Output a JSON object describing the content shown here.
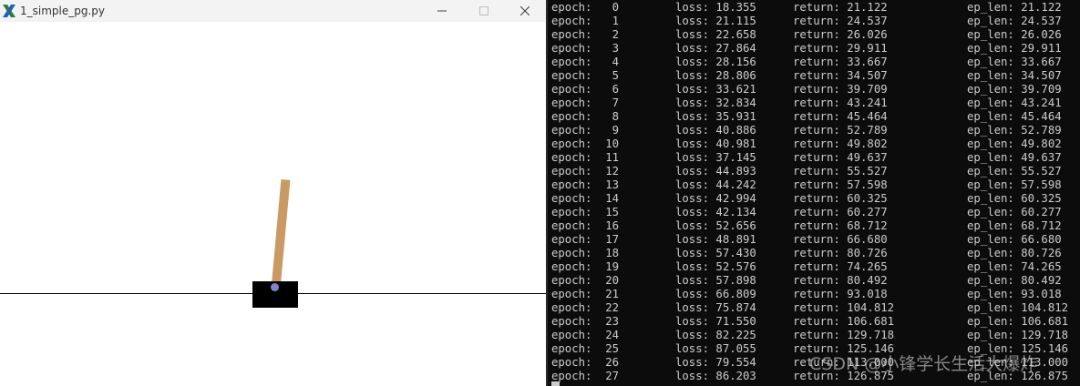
{
  "window": {
    "title": "1_simple_pg.py",
    "icon": "x-app-icon",
    "controls": [
      "minimize-icon",
      "maximize-icon",
      "close-icon"
    ]
  },
  "scene": {
    "track_color": "#000000",
    "cart_color": "#000000",
    "pole_color": "#ca9a65",
    "axle_color": "#8183cf"
  },
  "terminal": {
    "rows": [
      {
        "epoch": "epoch:   0",
        "loss": "loss: 18.355",
        "return": "return: 21.122",
        "ep_len": "ep_len: 21.122"
      },
      {
        "epoch": "epoch:   1",
        "loss": "loss: 21.115",
        "return": "return: 24.537",
        "ep_len": "ep_len: 24.537"
      },
      {
        "epoch": "epoch:   2",
        "loss": "loss: 22.658",
        "return": "return: 26.026",
        "ep_len": "ep_len: 26.026"
      },
      {
        "epoch": "epoch:   3",
        "loss": "loss: 27.864",
        "return": "return: 29.911",
        "ep_len": "ep_len: 29.911"
      },
      {
        "epoch": "epoch:   4",
        "loss": "loss: 28.156",
        "return": "return: 33.667",
        "ep_len": "ep_len: 33.667"
      },
      {
        "epoch": "epoch:   5",
        "loss": "loss: 28.806",
        "return": "return: 34.507",
        "ep_len": "ep_len: 34.507"
      },
      {
        "epoch": "epoch:   6",
        "loss": "loss: 33.621",
        "return": "return: 39.709",
        "ep_len": "ep_len: 39.709"
      },
      {
        "epoch": "epoch:   7",
        "loss": "loss: 32.834",
        "return": "return: 43.241",
        "ep_len": "ep_len: 43.241"
      },
      {
        "epoch": "epoch:   8",
        "loss": "loss: 35.931",
        "return": "return: 45.464",
        "ep_len": "ep_len: 45.464"
      },
      {
        "epoch": "epoch:   9",
        "loss": "loss: 40.886",
        "return": "return: 52.789",
        "ep_len": "ep_len: 52.789"
      },
      {
        "epoch": "epoch:  10",
        "loss": "loss: 40.981",
        "return": "return: 49.802",
        "ep_len": "ep_len: 49.802"
      },
      {
        "epoch": "epoch:  11",
        "loss": "loss: 37.145",
        "return": "return: 49.637",
        "ep_len": "ep_len: 49.637"
      },
      {
        "epoch": "epoch:  12",
        "loss": "loss: 44.893",
        "return": "return: 55.527",
        "ep_len": "ep_len: 55.527"
      },
      {
        "epoch": "epoch:  13",
        "loss": "loss: 44.242",
        "return": "return: 57.598",
        "ep_len": "ep_len: 57.598"
      },
      {
        "epoch": "epoch:  14",
        "loss": "loss: 42.994",
        "return": "return: 60.325",
        "ep_len": "ep_len: 60.325"
      },
      {
        "epoch": "epoch:  15",
        "loss": "loss: 42.134",
        "return": "return: 60.277",
        "ep_len": "ep_len: 60.277"
      },
      {
        "epoch": "epoch:  16",
        "loss": "loss: 52.656",
        "return": "return: 68.712",
        "ep_len": "ep_len: 68.712"
      },
      {
        "epoch": "epoch:  17",
        "loss": "loss: 48.891",
        "return": "return: 66.680",
        "ep_len": "ep_len: 66.680"
      },
      {
        "epoch": "epoch:  18",
        "loss": "loss: 57.430",
        "return": "return: 80.726",
        "ep_len": "ep_len: 80.726"
      },
      {
        "epoch": "epoch:  19",
        "loss": "loss: 52.576",
        "return": "return: 74.265",
        "ep_len": "ep_len: 74.265"
      },
      {
        "epoch": "epoch:  20",
        "loss": "loss: 57.898",
        "return": "return: 80.492",
        "ep_len": "ep_len: 80.492"
      },
      {
        "epoch": "epoch:  21",
        "loss": "loss: 66.809",
        "return": "return: 93.018",
        "ep_len": "ep_len: 93.018"
      },
      {
        "epoch": "epoch:  22",
        "loss": "loss: 75.874",
        "return": "return: 104.812",
        "ep_len": "ep_len: 104.812"
      },
      {
        "epoch": "epoch:  23",
        "loss": "loss: 71.550",
        "return": "return: 106.681",
        "ep_len": "ep_len: 106.681"
      },
      {
        "epoch": "epoch:  24",
        "loss": "loss: 82.225",
        "return": "return: 129.718",
        "ep_len": "ep_len: 129.718"
      },
      {
        "epoch": "epoch:  25",
        "loss": "loss: 87.055",
        "return": "return: 125.146",
        "ep_len": "ep_len: 125.146"
      },
      {
        "epoch": "epoch:  26",
        "loss": "loss: 79.554",
        "return": "return: 113.000",
        "ep_len": "ep_len: 113.000"
      },
      {
        "epoch": "epoch:  27",
        "loss": "loss: 86.203",
        "return": "return: 126.875",
        "ep_len": "ep_len: 126.875"
      }
    ]
  },
  "watermark": "CSDN @小锋学长生活大爆炸"
}
